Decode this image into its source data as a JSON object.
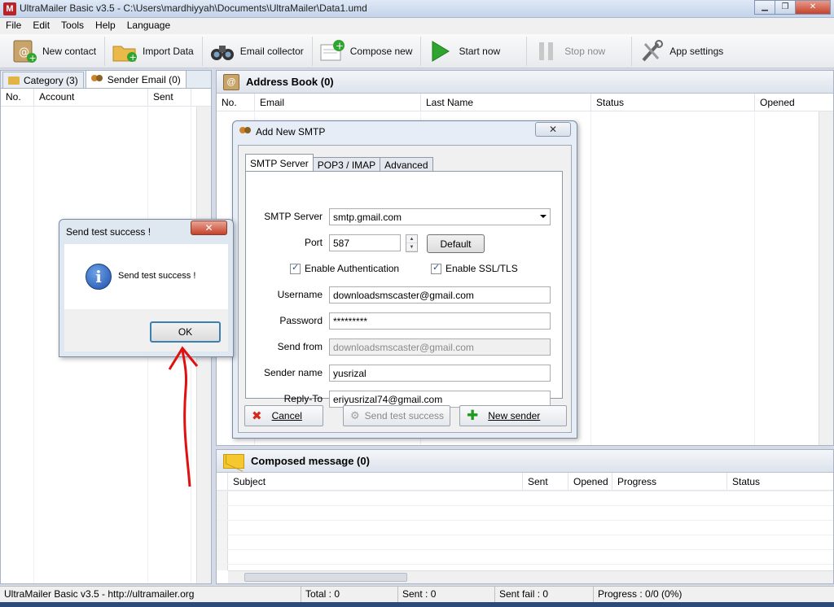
{
  "window": {
    "title": "UltraMailer Basic v3.5 - C:\\Users\\mardhiyyah\\Documents\\UltraMailer\\Data1.umd",
    "app_icon_letter": "M",
    "btn_minimize": "▁",
    "btn_maximize": "❐",
    "btn_close": "✕"
  },
  "menu": [
    "File",
    "Edit",
    "Tools",
    "Help",
    "Language"
  ],
  "toolbar": {
    "new_contact": "New contact",
    "import_data": "Import Data",
    "email_collector": "Email collector",
    "compose_new": "Compose new",
    "start_now": "Start now",
    "stop_now": "Stop now",
    "app_settings": "App settings"
  },
  "left_panel": {
    "tabs": [
      "Category (3)",
      "Sender Email (0)"
    ],
    "columns": [
      "No.",
      "Account",
      "Sent"
    ]
  },
  "address_book": {
    "title": "Address Book (0)",
    "columns": [
      "No.",
      "Email",
      "Last Name",
      "Status",
      "Opened"
    ]
  },
  "composed": {
    "title": "Composed message (0)",
    "columns": [
      "Subject",
      "Sent",
      "Opened",
      "Progress",
      "Status"
    ]
  },
  "status_bar": {
    "app": "UltraMailer Basic v3.5 - http://ultramailer.org",
    "total": "Total : 0",
    "sent": "Sent : 0",
    "sent_fail": "Sent fail : 0",
    "progress": "Progress : 0/0 (0%)"
  },
  "smtp_dialog": {
    "title": "Add New SMTP",
    "close": "✕",
    "tabs": [
      "SMTP Server",
      "POP3 / IMAP",
      "Advanced"
    ],
    "labels": {
      "smtp_server": "SMTP Server",
      "port": "Port",
      "username": "Username",
      "password": "Password",
      "send_from": "Send from",
      "sender_name": "Sender name",
      "reply_to": "Reply-To"
    },
    "values": {
      "smtp_server": "smtp.gmail.com",
      "port": "587",
      "username": "downloadsmscaster@gmail.com",
      "password": "*********",
      "send_from": "downloadsmscaster@gmail.com",
      "sender_name": "yusrizal",
      "reply_to": "eriyusrizal74@gmail.com"
    },
    "default_button": "Default",
    "enable_auth": "Enable Authentication",
    "enable_ssl": "Enable SSL/TLS",
    "cancel": "Cancel",
    "send_test": "Send test success",
    "new_sender": "New sender"
  },
  "message_box": {
    "title": "Send test success !",
    "message": "Send test success !",
    "ok": "OK",
    "close": "✕"
  },
  "colors": {
    "annotation_arrow": "#e01010",
    "window_bg": "#d4dbe6"
  }
}
